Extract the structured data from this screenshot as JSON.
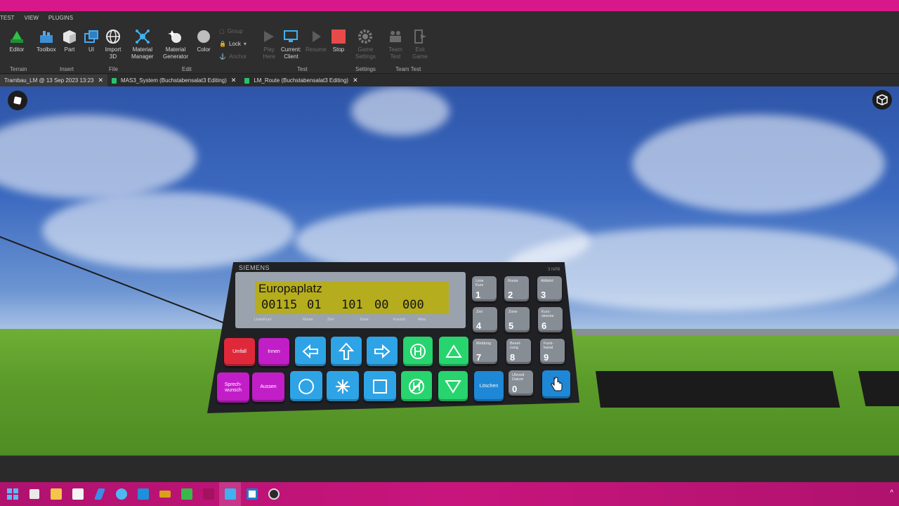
{
  "menu": [
    "TEST",
    "VIEW",
    "PLUGINS"
  ],
  "ribbon": {
    "tools": [
      {
        "label": "Editor",
        "icon": "terrain-editor-icon"
      },
      {
        "label": "Toolbox",
        "icon": "toolbox-icon"
      },
      {
        "label": "Part",
        "icon": "part-cube-icon"
      },
      {
        "label": "UI",
        "icon": "ui-icon"
      },
      {
        "label": "Import\n3D",
        "icon": "import-3d-icon"
      },
      {
        "label": "Material\nManager",
        "icon": "material-manager-icon"
      },
      {
        "label": "Material\nGenerator",
        "icon": "material-generator-icon"
      },
      {
        "label": "Color",
        "icon": "color-icon"
      },
      {
        "label": "Play\nHere",
        "icon": "play-here-icon"
      },
      {
        "label": "Current:\nClient",
        "icon": "client-icon"
      },
      {
        "label": "Resume",
        "icon": "resume-icon"
      },
      {
        "label": "Stop",
        "icon": "stop-icon"
      },
      {
        "label": "Game\nSettings",
        "icon": "game-settings-icon"
      },
      {
        "label": "Team\nTest",
        "icon": "team-test-icon"
      },
      {
        "label": "Exit\nGame",
        "icon": "exit-game-icon"
      }
    ],
    "small_tools": {
      "group": "Group",
      "lock": "Lock",
      "anchor": "Anchor"
    },
    "groups": [
      "Terrain",
      "Insert",
      "File",
      "Edit",
      "Test",
      "Settings",
      "Team Test"
    ]
  },
  "tabs": [
    {
      "label": "Trambau_LM @ 13 Sep 2023 13:23",
      "active": true
    },
    {
      "label": "MAS3_System (Buchstabensalat3 Editing)",
      "active": false
    },
    {
      "label": "LM_Route (Buchstabensalat3 Editing)",
      "active": false
    }
  ],
  "device": {
    "brand": "SIEMENS",
    "model": "3 NPB",
    "lcd_line1": "Europaplatz",
    "lcd_line2": [
      "00115",
      "01",
      "101",
      "00",
      "000"
    ],
    "lcd_labels": [
      "Linie/Kurs",
      "Route",
      "Ziel",
      "Zone",
      "Kurzstr.",
      "Abw."
    ],
    "keys_row1": [
      "Umfall",
      "Innen"
    ],
    "keys_row2": [
      "Sprech-\nwunsch",
      "Aussen"
    ],
    "key_loeschen": "Löschen",
    "numpad": [
      {
        "label": "Linie\nKurs",
        "num": "1"
      },
      {
        "label": "Route",
        "num": "2"
      },
      {
        "label": "Abfahrt",
        "num": "3"
      },
      {
        "label": "Ziel",
        "num": "4"
      },
      {
        "label": "Zone",
        "num": "5"
      },
      {
        "label": "Kurz-\nstrecke",
        "num": "6"
      },
      {
        "label": "Meldung",
        "num": "7"
      },
      {
        "label": "Beset-\nzung",
        "num": "8"
      },
      {
        "label": "Funk-\nkanal",
        "num": "9"
      },
      {
        "label": "Uhrzeit\nDatum",
        "num": "0"
      }
    ]
  },
  "colors": {
    "accent": "#d8178a",
    "lcd": "#b5ad1e",
    "key_green": "#27d46e",
    "key_blue": "#2ea4e6",
    "key_magenta": "#c21ec8",
    "key_red": "#e0283b"
  }
}
